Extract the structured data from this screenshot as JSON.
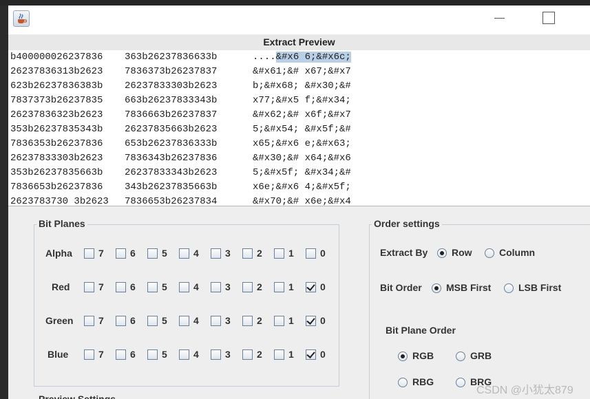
{
  "window": {
    "title": "Extract Preview"
  },
  "preview": {
    "rows": [
      [
        "b400000026237836",
        "363b26237836633b",
        "....&#x6 6;&#x6c;"
      ],
      [
        "26237836313b2623",
        "7836373b26237837",
        "&#x61;&# x67;&#x7"
      ],
      [
        "623b26237836383b",
        "26237833303b2623",
        "b;&#x68; &#x30;&#"
      ],
      [
        "7837373b26237835",
        "663b26237833343b",
        "x77;&#x5 f;&#x34;"
      ],
      [
        "26237836323b2623",
        "7836663b26237837",
        "&#x62;&# x6f;&#x7"
      ],
      [
        "353b26237835343b",
        "26237835663b2623",
        "5;&#x54; &#x5f;&#"
      ],
      [
        "7836353b26237836",
        "653b26237836333b",
        "x65;&#x6 e;&#x63;"
      ],
      [
        "26237833303b2623",
        "7836343b26237836",
        "&#x30;&# x64;&#x6"
      ],
      [
        "353b26237835663b",
        "26237833343b2623",
        "5;&#x5f; &#x34;&#"
      ],
      [
        "7836653b26237836",
        "343b26237835663b",
        "x6e;&#x6 4;&#x5f;"
      ],
      [
        "2623783730 3b2623",
        "7836653b26237834",
        "&#x70;&# x6e;&#x4"
      ]
    ],
    "first_row_prefix": "....",
    "first_row_highlight": "&#x6 6;&#x6c;"
  },
  "bit_planes": {
    "title": "Bit Planes",
    "channels": [
      {
        "name": "Alpha",
        "checked": []
      },
      {
        "name": "Red",
        "checked": [
          "0"
        ]
      },
      {
        "name": "Green",
        "checked": [
          "0"
        ]
      },
      {
        "name": "Blue",
        "checked": [
          "0"
        ]
      }
    ],
    "bits": [
      "7",
      "6",
      "5",
      "4",
      "3",
      "2",
      "1",
      "0"
    ]
  },
  "order_settings": {
    "title": "Order settings",
    "extract_by": {
      "label": "Extract By",
      "options": [
        "Row",
        "Column"
      ],
      "selected": "Row"
    },
    "bit_order": {
      "label": "Bit Order",
      "options": [
        "MSB First",
        "LSB First"
      ],
      "selected": "MSB First"
    },
    "bit_plane_order": {
      "label": "Bit Plane Order",
      "options": [
        "RGB",
        "GRB",
        "RBG",
        "BRG"
      ],
      "selected": "RGB"
    }
  },
  "preview_settings": {
    "title": "Preview Settings"
  },
  "watermark": "CSDN @小犹太879",
  "colors": {
    "highlight": "#b8cfe5",
    "border": "#c4ccd8",
    "background": "#eeeeee"
  }
}
